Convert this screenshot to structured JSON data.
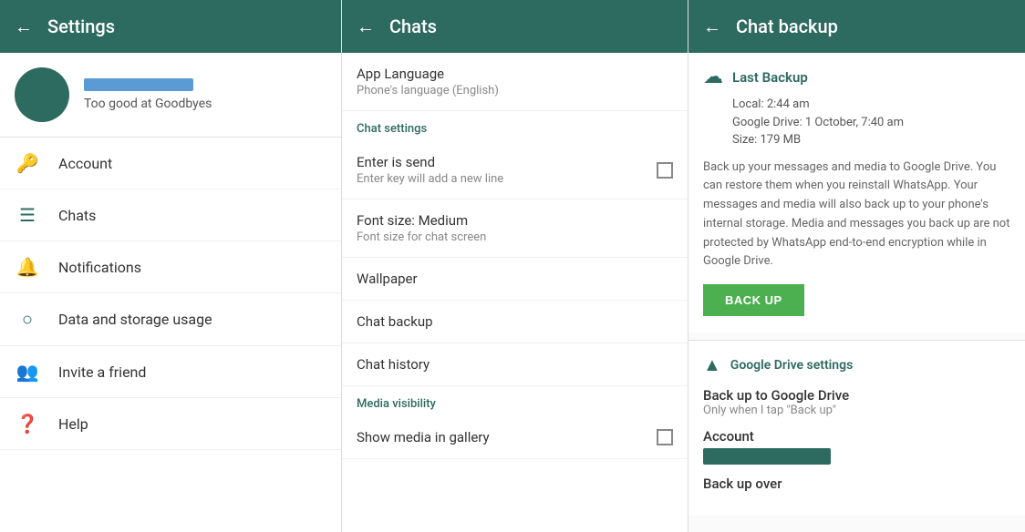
{
  "settings": {
    "header": {
      "title": "Settings",
      "back_arrow": "←"
    },
    "profile": {
      "status": "Too good at Goodbyes"
    },
    "items": [
      {
        "id": "account",
        "label": "Account",
        "icon": "🔑"
      },
      {
        "id": "chats",
        "label": "Chats",
        "icon": "☰"
      },
      {
        "id": "notifications",
        "label": "Notifications",
        "icon": "🔔"
      },
      {
        "id": "data-storage",
        "label": "Data and storage usage",
        "icon": "○"
      },
      {
        "id": "invite",
        "label": "Invite a friend",
        "icon": "👥"
      },
      {
        "id": "help",
        "label": "Help",
        "icon": "❓"
      }
    ]
  },
  "chats": {
    "header": {
      "title": "Chats",
      "back_arrow": "←"
    },
    "app_language": {
      "title": "App Language",
      "subtitle": "Phone's language (English)"
    },
    "section_label": "Chat settings",
    "items": [
      {
        "id": "enter-send",
        "title": "Enter is send",
        "subtitle": "Enter key will add a new line",
        "has_checkbox": true
      },
      {
        "id": "font-size",
        "title": "Font size: Medium",
        "subtitle": "Font size for chat screen",
        "has_checkbox": false
      },
      {
        "id": "wallpaper",
        "title": "Wallpaper",
        "subtitle": "",
        "has_checkbox": false
      },
      {
        "id": "chat-backup",
        "title": "Chat backup",
        "subtitle": "",
        "has_checkbox": false
      },
      {
        "id": "chat-history",
        "title": "Chat history",
        "subtitle": "",
        "has_checkbox": false
      }
    ],
    "media_visibility_label": "Media visibility",
    "show_media": {
      "title": "Show media in gallery",
      "has_checkbox": true
    }
  },
  "chat_backup": {
    "header": {
      "title": "Chat backup",
      "back_arrow": "←"
    },
    "last_backup": {
      "section_title": "Last Backup",
      "local": "Local: 2:44 am",
      "google_drive": "Google Drive: 1 October, 7:40 am",
      "size": "Size: 179 MB",
      "description": "Back up your messages and media to Google Drive. You can restore them when you reinstall WhatsApp. Your messages and media will also back up to your phone's internal storage. Media and messages you back up are not protected by WhatsApp end-to-end encryption while in Google Drive.",
      "button_label": "BACK UP"
    },
    "google_drive": {
      "section_title": "Google Drive settings",
      "backup_to_drive": {
        "title": "Back up to Google Drive",
        "subtitle": "Only when I tap \"Back up\""
      },
      "account": {
        "title": "Account"
      },
      "backup_over": {
        "title": "Back up over"
      }
    }
  }
}
